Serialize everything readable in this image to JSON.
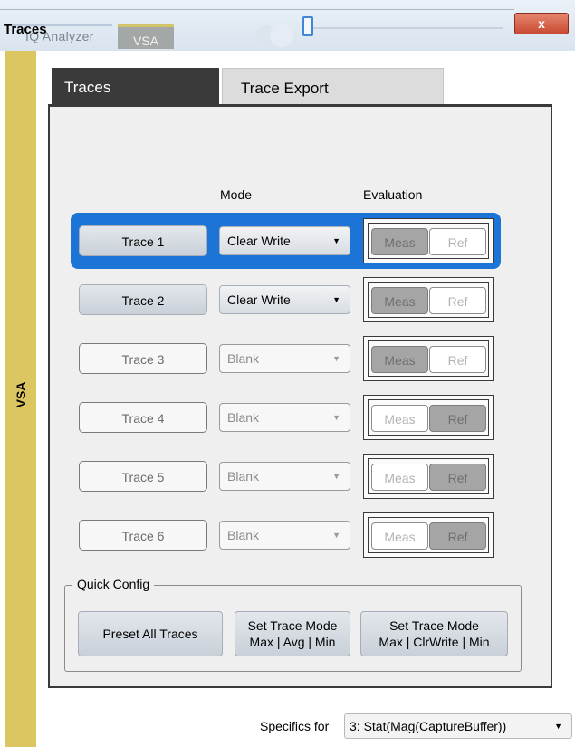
{
  "window": {
    "title": "Traces",
    "app_tab_label": "IQ Analyzer",
    "vsa_tab_label": "VSA",
    "close_symbol": "x",
    "slider_level": 0.0
  },
  "side_strip": {
    "label": "VSA"
  },
  "tabs": [
    {
      "label": "Traces",
      "active": true
    },
    {
      "label": "Trace Export",
      "active": false
    }
  ],
  "columns": {
    "mode": "Mode",
    "evaluation": "Evaluation"
  },
  "traces": [
    {
      "label": "Trace 1",
      "enabled": true,
      "mode": "Clear Write",
      "meas": "Meas",
      "ref": "Ref",
      "active_toggle": "meas",
      "selected": true
    },
    {
      "label": "Trace 2",
      "enabled": true,
      "mode": "Clear Write",
      "meas": "Meas",
      "ref": "Ref",
      "active_toggle": "meas",
      "selected": false
    },
    {
      "label": "Trace 3",
      "enabled": false,
      "mode": "Blank",
      "meas": "Meas",
      "ref": "Ref",
      "active_toggle": "meas",
      "selected": false
    },
    {
      "label": "Trace 4",
      "enabled": false,
      "mode": "Blank",
      "meas": "Meas",
      "ref": "Ref",
      "active_toggle": "ref",
      "selected": false
    },
    {
      "label": "Trace 5",
      "enabled": false,
      "mode": "Blank",
      "meas": "Meas",
      "ref": "Ref",
      "active_toggle": "ref",
      "selected": false
    },
    {
      "label": "Trace 6",
      "enabled": false,
      "mode": "Blank",
      "meas": "Meas",
      "ref": "Ref",
      "active_toggle": "ref",
      "selected": false
    }
  ],
  "quick_config": {
    "legend": "Quick Config",
    "buttons": [
      {
        "line1": "Preset All Traces",
        "line2": ""
      },
      {
        "line1": "Set Trace Mode",
        "line2": "Max | Avg | Min"
      },
      {
        "line1": "Set Trace Mode",
        "line2": "Max | ClrWrite | Min"
      }
    ]
  },
  "specifics": {
    "label": "Specifics for",
    "value": "3: Stat(Mag(CaptureBuffer))"
  },
  "colors": {
    "selected_row": "#1c75d6",
    "side_strip": "#dcc661",
    "active_tab": "#3a3a3a",
    "close_button": "#c84a32"
  },
  "icons": {
    "caret": "dropdown-caret-icon",
    "close": "close-icon"
  }
}
